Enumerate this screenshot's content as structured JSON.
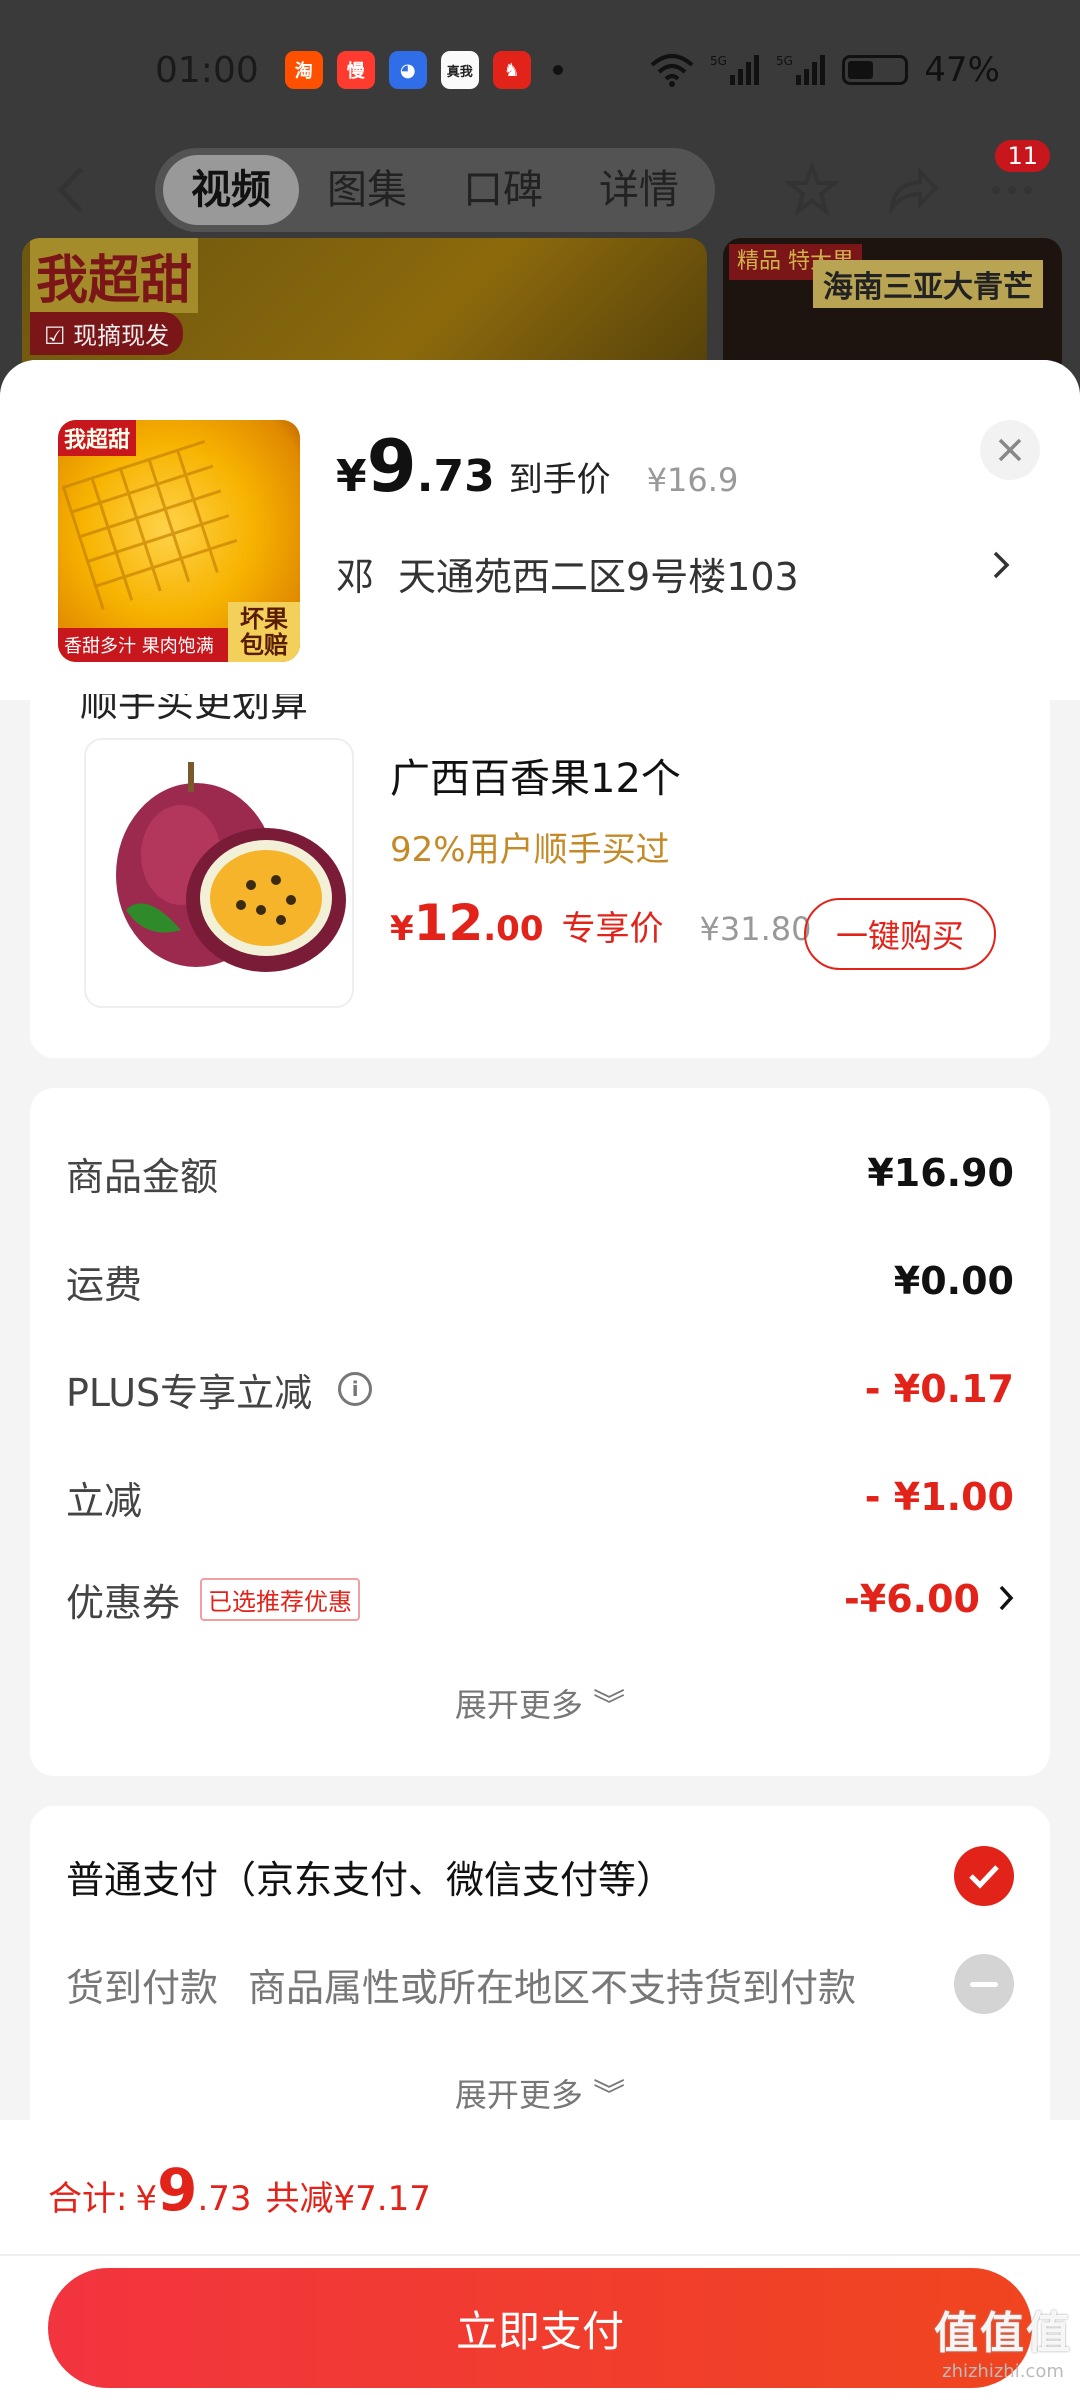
{
  "status_bar": {
    "time": "01:00",
    "battery_percent": "47%",
    "battery_level": 0.47,
    "app_icons": [
      {
        "name": "taobao-app-icon",
        "glyph": "淘",
        "color": "#ff5000"
      },
      {
        "name": "man-app-icon",
        "glyph": "慢",
        "color": "#ff3b2f"
      },
      {
        "name": "baidu-app-icon",
        "glyph": "◕",
        "color": "#2f6ee8"
      },
      {
        "name": "realme-app-icon",
        "glyph": "真我",
        "color": "#fafafa"
      },
      {
        "name": "jd-app-icon",
        "glyph": "♞",
        "color": "#e2231a"
      }
    ]
  },
  "nav": {
    "tabs": [
      "视频",
      "图集",
      "口碑",
      "详情"
    ],
    "active_tab": 0,
    "badge": "11"
  },
  "background_images": {
    "left_title": "我超甜",
    "left_tag": "☑ 现摘现发",
    "right_tag": "精品 特大果",
    "right_title": "海南三亚大青芒"
  },
  "product": {
    "price_symbol": "¥",
    "price_int": "9",
    "price_dec": ".73",
    "price_label": "到手价",
    "original_price": "¥16.9",
    "thumb_tag_top": "我超甜",
    "thumb_tag_bottom": "香甜多汁 果肉饱满",
    "thumb_tag_corner": "坏果包赔"
  },
  "address": {
    "name": "邓",
    "detail": "天通苑西二区9号楼103"
  },
  "recommend": {
    "section_title_cut": "顺手买更划算",
    "title": "广西百香果12个",
    "subtitle": "92%用户顺手买过",
    "price_symbol": "¥",
    "price_int": "12",
    "price_dec": ".00",
    "price_label": "专享价",
    "original_price": "¥31.80",
    "button": "一键购买"
  },
  "costs": {
    "rows": [
      {
        "label": "商品金额",
        "value": "¥16.90"
      },
      {
        "label": "运费",
        "value": "¥0.00"
      },
      {
        "label": "PLUS专享立减",
        "value": "- ¥0.17"
      },
      {
        "label": "立减",
        "value": "- ¥1.00"
      },
      {
        "label": "优惠券",
        "value": "-¥6.00"
      }
    ],
    "coupon_badge": "已选推荐优惠",
    "expand": "展开更多 ︾"
  },
  "payment": {
    "normal": "普通支付（京东支付、微信支付等）",
    "cod_label": "货到付款",
    "cod_note": "商品属性或所在地区不支持货到付款",
    "expand": "展开更多 ︾"
  },
  "total": {
    "label": "合计:",
    "symbol": "¥",
    "int": "9",
    "dec": ".73",
    "saved": "共减¥7.17"
  },
  "pay_button": "立即支付",
  "watermark": {
    "main": "值值值",
    "sub": "zhizhizhi.com"
  },
  "colors": {
    "accent_red": "#e2231a",
    "subtitle_gold": "#c48a28"
  }
}
